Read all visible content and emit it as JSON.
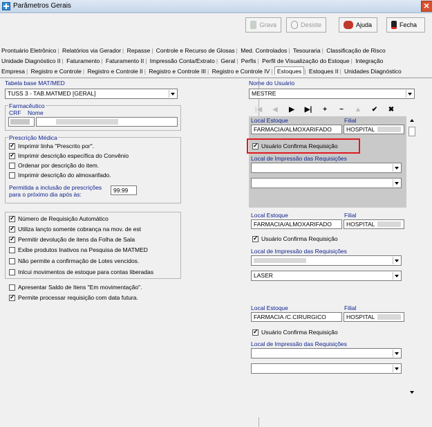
{
  "window": {
    "title": "Parâmetros Gerais"
  },
  "toolbar": {
    "grava": "Grava",
    "desiste": "Desiste",
    "ajuda": "Ajuda",
    "fecha": "Fecha"
  },
  "tabs_row1": [
    "Prontuário Eletrônico",
    "Relatórios via Gerador",
    "Repasse",
    "Controle e Recurso de Glosas",
    "Med. Controlados",
    "Tesouraria",
    "Classificação de Risco"
  ],
  "tabs_row2": [
    "Unidade Diagnóstico II",
    "Faturamento",
    "Faturamento II",
    "Impressão Conta/Extrato",
    "Geral",
    "Perfis",
    "Perfil de Visualização do Estoque",
    "Integração"
  ],
  "tabs_row3": [
    "Empresa",
    "Registro e Controle",
    "Registro e Controle II",
    "Registro e Controle III",
    "Registro e Controle IV",
    "Estoques",
    "Estoques II",
    "Unidades Diagnóstico"
  ],
  "left": {
    "tabela_label": "Tabela base MAT/MED",
    "tabela_value": "TUSS 3 - TAB.MATMED [GERAL]",
    "farmaceutico_title": "Farmacêutico",
    "crf_label": "CRF",
    "nome_label": "Nome",
    "prescricao_title": "Prescrição Médica",
    "prescricao_checks": [
      {
        "label": "Imprimir linha \"Prescrito por\".",
        "checked": true
      },
      {
        "label": "Imprimir descrição específica do Convênio",
        "checked": true
      },
      {
        "label": "Ordenar por descrição do item.",
        "checked": false
      },
      {
        "label": "Imprimir descrição do almoxarifado.",
        "checked": false
      }
    ],
    "permitida_line1": "Permitida a inclusão de prescrições",
    "permitida_line2": "para o próximo dia após às:",
    "permitida_value": "99:99",
    "group2_checks": [
      {
        "label": "Número de Requisição Automático",
        "checked": true
      },
      {
        "label": "Utiliza lançto somente cobrança na mov. de est",
        "checked": true
      },
      {
        "label": "Permitir devolução de itens da Folha de Sala",
        "checked": true
      },
      {
        "label": "Exibe produtos Inativos na Pesquisa de MATMED",
        "checked": false
      },
      {
        "label": "Não permite a confirmação de Lotes vencidos.",
        "checked": false
      },
      {
        "label": "Inlcui movimentos de estoque para contas liberadas",
        "checked": false
      }
    ],
    "extra_checks": [
      {
        "label": "Apresentar Saldo de Itens \"Em movimentação\".",
        "checked": false
      },
      {
        "label": "Permite processar requisição com data futura.",
        "checked": true
      }
    ]
  },
  "right": {
    "nome_usuario_label": "Nome do Usuário",
    "nome_usuario_value": "MESTRE",
    "nav": [
      "|◀",
      "◀",
      "▶",
      "▶|",
      "+",
      "−",
      "▲",
      "✔",
      "✖"
    ],
    "local_label": "Local Estoque",
    "filial_label": "Filial",
    "confirma_label": "Usuário Confirma Requisição",
    "impressao_label": "Local de Impressão das Requisições",
    "records": [
      {
        "local": "FARMACIA/ALMOXARIFADO",
        "filial": "HOSPITAL",
        "confirma": true,
        "print1": "",
        "print2": ""
      },
      {
        "local": "FARMACIA/ALMOXARIFADO",
        "filial": "HOSPITAL",
        "confirma": true,
        "print1": "",
        "print2": "LASER"
      },
      {
        "local": "FARMACIA /C.CIRURGICO",
        "filial": "HOSPITAL",
        "confirma": true,
        "print1": "",
        "print2": ""
      }
    ]
  }
}
